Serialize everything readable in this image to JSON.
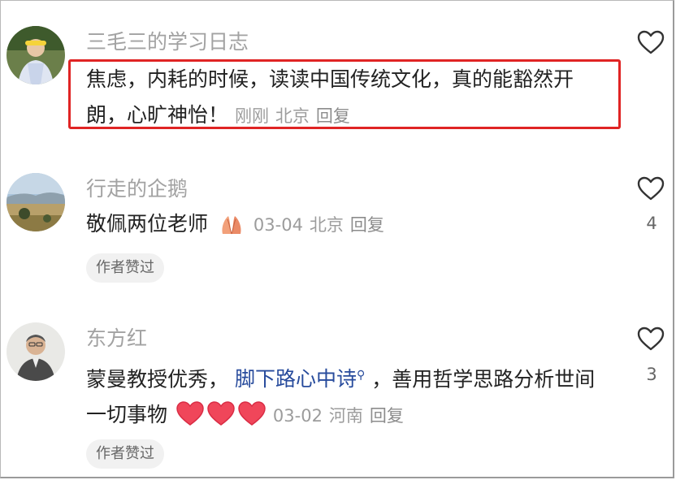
{
  "comments": [
    {
      "username": "三毛三的学习日志",
      "text": "焦虑，内耗的时候，读读中国传统文化，真的能豁然开朗，心旷神怡！",
      "time": "刚刚",
      "location": "北京",
      "reply": "回复",
      "likes": "",
      "highlighted": true,
      "accent": "#e02424"
    },
    {
      "username": "行走的企鹅",
      "text": "敬佩两位老师",
      "emoji": "folded-hands-emoji",
      "time": "03-04",
      "location": "北京",
      "reply": "回复",
      "likes": "4",
      "badge": "作者赞过"
    },
    {
      "username": "东方红",
      "text_before": "蒙曼教授优秀，",
      "link": "脚下路心中诗",
      "text_after": "，善用哲学思路分析世间一切事物",
      "emoji": "red-heart-emoji x3",
      "time": "03-02",
      "location": "河南",
      "reply": "回复",
      "likes": "3",
      "badge": "作者赞过"
    }
  ]
}
